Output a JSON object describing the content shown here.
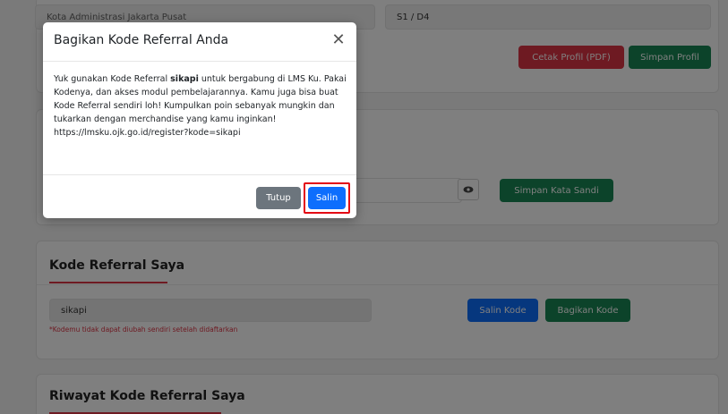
{
  "background": {
    "top_field_left": "Kota Administrasi Jakarta Pusat",
    "top_field_right": "S1 / D4",
    "print_profile_button": "Cetak Profil (PDF)",
    "save_profile_button": "Simpan Profil",
    "save_password_button": "Simpan Kata Sandi",
    "referral_section": {
      "title": "Kode Referral Saya",
      "code_value": "sikapi",
      "hint": "*Kodemu tidak dapat diubah sendiri setelah didaftarkan",
      "copy_button": "Salin Kode",
      "share_button": "Bagikan Kode"
    },
    "history_section": {
      "title": "Riwayat Kode Referral Saya"
    }
  },
  "modal": {
    "title": "Bagikan Kode Referral Anda",
    "close_glyph": "✕",
    "body_part1": "Yuk gunakan Kode Referral ",
    "body_code": "sikapi",
    "body_part2": " untuk bergabung di LMS Ku. Pakai Kodenya, dan akses modul pembelajarannya. Kamu juga bisa buat Kode Referral sendiri loh! Kumpulkan poin sebanyak mungkin dan tukarkan dengan merchandise yang kamu inginkan!",
    "body_link": "https://lmsku.ojk.go.id/register?kode=sikapi",
    "close_button": "Tutup",
    "copy_button": "Salin"
  },
  "colors": {
    "accent_blue": "#0d6efd",
    "accent_green": "#198754",
    "accent_red": "#dc3545",
    "highlight": "#e30613"
  },
  "icons": {
    "eye": "eye-icon",
    "close": "close-icon"
  }
}
